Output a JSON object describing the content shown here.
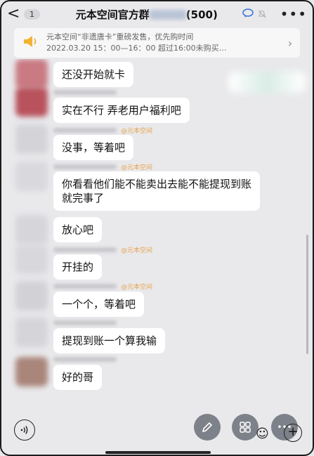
{
  "header": {
    "back_glyph": "<",
    "badge": "1",
    "title_left": "元本空间官方群",
    "title_right": "(500)"
  },
  "notice": {
    "line1": "元本空间“非遗唐卡”重磅发售，优先购时间",
    "line2": "2022.03.20 15：00—16：00 超过16:00未购买…",
    "icon": "megaphone-icon"
  },
  "messages": [
    {
      "text": "还没开始就卡",
      "watermark": ""
    },
    {
      "text": "实在不行 弄老用户福利吧",
      "watermark": ""
    },
    {
      "text": "没事，等着吧",
      "watermark": "@元本空间"
    },
    {
      "text": "你看看他们能不能卖出去能不能提现到账就完事了",
      "watermark": "@元本空间"
    },
    {
      "text": "放心吧",
      "watermark": ""
    },
    {
      "text": "开挂的",
      "watermark": "@元本空间"
    },
    {
      "text": "一个个，等着吧",
      "watermark": "@元本空间"
    },
    {
      "text": "提现到账一个算我输",
      "watermark": ""
    },
    {
      "text": "好的哥",
      "watermark": ""
    }
  ],
  "bottom": {
    "icons": [
      "voice-icon",
      "pencil-icon",
      "grid-icon",
      "emoji-icon",
      "more-icon",
      "plus-icon"
    ],
    "more_glyph": "•••",
    "plus_glyph": "+",
    "emoji_glyph": "☺"
  },
  "colors": {
    "background": "#e9e9ec",
    "bubble": "#ffffff",
    "watermark": "#e8a24b",
    "fab": "#7d8189"
  }
}
